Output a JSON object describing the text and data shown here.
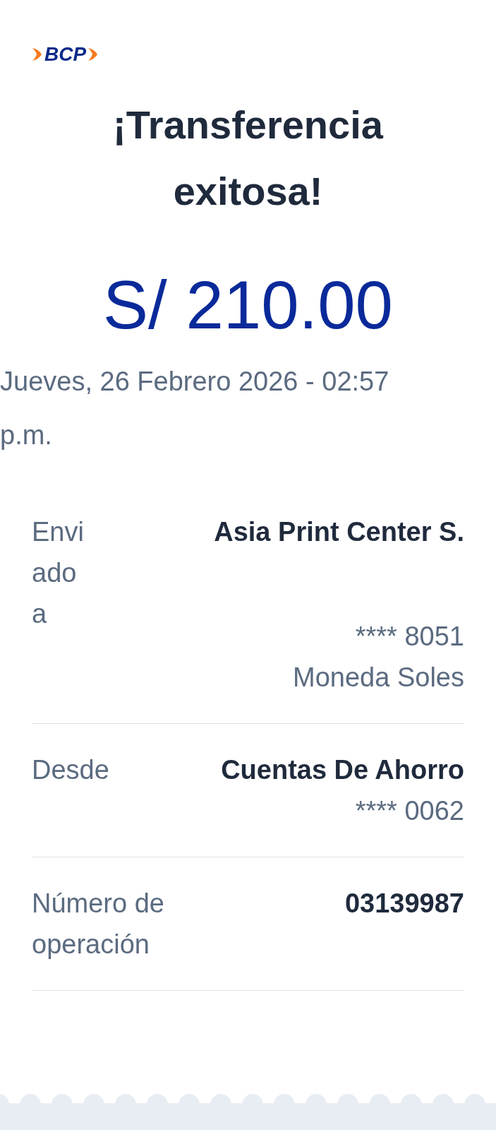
{
  "logo": {
    "text": "BCP"
  },
  "title": "¡Transferencia exitosa!",
  "amount": "S/ 210.00",
  "datetime": "Jueves, 26 Febrero 2026 - 02:57 p.m.",
  "details": [
    {
      "label": "Enviado a",
      "value": "Asia Print Center S.",
      "extra": [
        "**** 8051",
        "Moneda Soles"
      ],
      "kind": "spaced"
    },
    {
      "label": "Desde",
      "value": "Cuentas De Ahorro",
      "extra": [
        "**** 0062"
      ],
      "kind": "tight"
    },
    {
      "label": "Número de operación",
      "value": "03139987",
      "kind": "tight"
    }
  ]
}
